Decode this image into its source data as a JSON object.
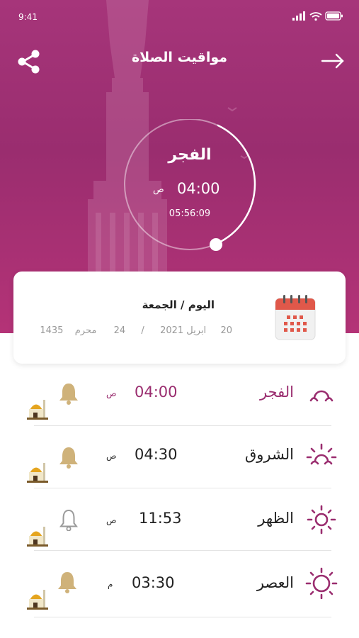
{
  "status_bar": {
    "time": "9:41"
  },
  "header": {
    "title": "مواقيت الصلاة"
  },
  "current_prayer": {
    "name": "الفجر",
    "time": "04:00",
    "ampm": "ص",
    "countdown": "05:56:09"
  },
  "date_card": {
    "day_label": "اليوم / الجمعة",
    "gregorian_day": "20",
    "gregorian_month_year": "ابريل 2021",
    "separator": "/",
    "hijri_day": "24",
    "hijri_month": "محرم",
    "hijri_year": "1435"
  },
  "prayers": [
    {
      "name": "الفجر",
      "time": "04:00",
      "ampm": "ص",
      "icon": "fajr-icon",
      "bell": "filled",
      "highlight": true
    },
    {
      "name": "الشروق",
      "time": "04:30",
      "ampm": "ص",
      "icon": "sunrise-icon",
      "bell": "filled",
      "highlight": false
    },
    {
      "name": "الظهر",
      "time": "11:53",
      "ampm": "ص",
      "icon": "sun-icon",
      "bell": "outline",
      "highlight": false
    },
    {
      "name": "العصر",
      "time": "03:30",
      "ampm": "م",
      "icon": "afternoon-sun-icon",
      "bell": "filled",
      "highlight": false
    }
  ],
  "colors": {
    "brand": "#9a2d6f",
    "bell_gold": "#cfb27a",
    "calendar_red": "#e0584a"
  }
}
